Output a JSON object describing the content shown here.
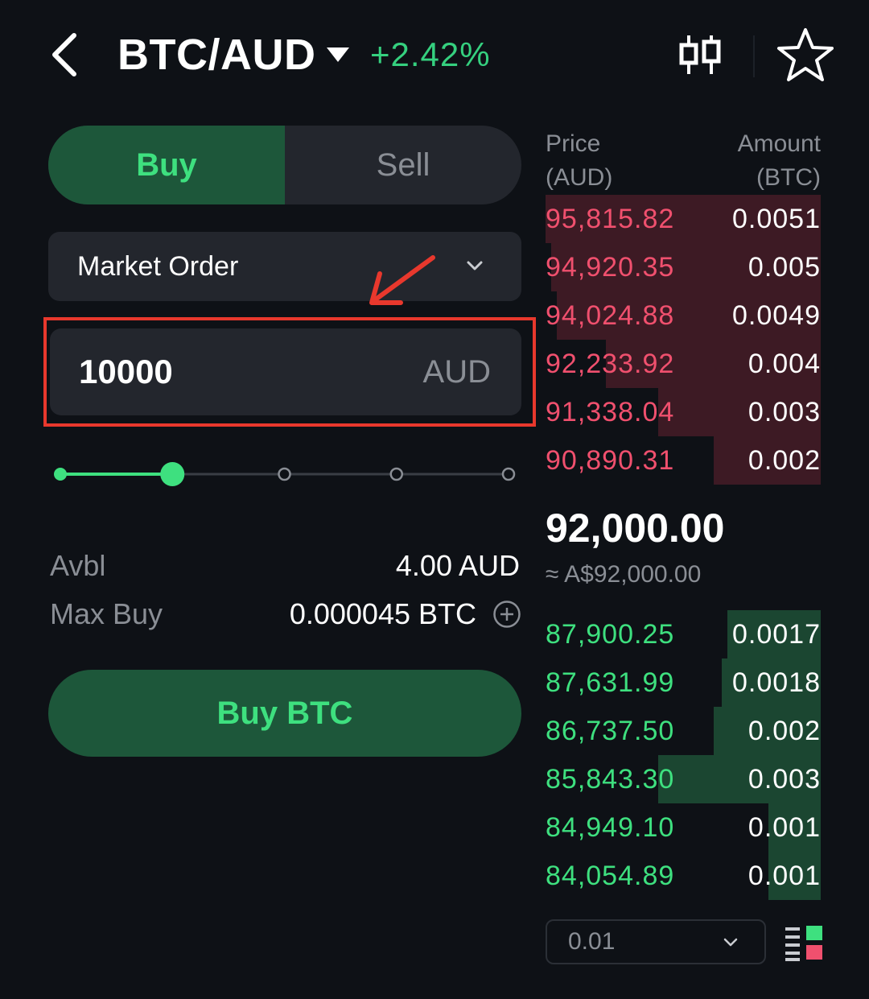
{
  "header": {
    "pair": "BTC/AUD",
    "change": "+2.42%",
    "icons": [
      "back-icon",
      "dropdown-caret-icon",
      "candlestick-chart-icon",
      "star-icon"
    ]
  },
  "tabs": {
    "buy": "Buy",
    "sell": "Sell",
    "selected": "Buy"
  },
  "order_type": {
    "label": "Market Order"
  },
  "amount": {
    "value": "10000",
    "unit": "AUD"
  },
  "slider": {
    "level_fraction": 0.25,
    "steps": 5
  },
  "info": {
    "avbl_label": "Avbl",
    "avbl_value": "4.00 AUD",
    "maxbuy_label": "Max Buy",
    "maxbuy_value": "0.000045 BTC"
  },
  "buy_button": "Buy BTC",
  "orderbook": {
    "price_header_1": "Price",
    "price_header_2": "(AUD)",
    "amount_header_1": "Amount",
    "amount_header_2": "(BTC)",
    "asks": [
      {
        "price": "95,815.82",
        "amount": "0.0051",
        "depth": 1.0
      },
      {
        "price": "94,920.35",
        "amount": "0.005",
        "depth": 0.98
      },
      {
        "price": "94,024.88",
        "amount": "0.0049",
        "depth": 0.96
      },
      {
        "price": "92,233.92",
        "amount": "0.004",
        "depth": 0.78
      },
      {
        "price": "91,338.04",
        "amount": "0.003",
        "depth": 0.59
      },
      {
        "price": "90,890.31",
        "amount": "0.002",
        "depth": 0.39
      }
    ],
    "last_price": "92,000.00",
    "last_price_fiat": "≈ A$92,000.00",
    "bids": [
      {
        "price": "87,900.25",
        "amount": "0.0017",
        "depth": 0.34
      },
      {
        "price": "87,631.99",
        "amount": "0.0018",
        "depth": 0.36
      },
      {
        "price": "86,737.50",
        "amount": "0.002",
        "depth": 0.39
      },
      {
        "price": "85,843.30",
        "amount": "0.003",
        "depth": 0.59
      },
      {
        "price": "84,949.10",
        "amount": "0.001",
        "depth": 0.19
      },
      {
        "price": "84,054.89",
        "amount": "0.001",
        "depth": 0.19
      }
    ],
    "depth_step": "0.01"
  },
  "colors": {
    "background": "#0e1116",
    "buy_green": "#3ee07f",
    "buy_bg": "#1d573a",
    "ask_red": "#f0506e",
    "annotation_red": "#e8382d"
  }
}
